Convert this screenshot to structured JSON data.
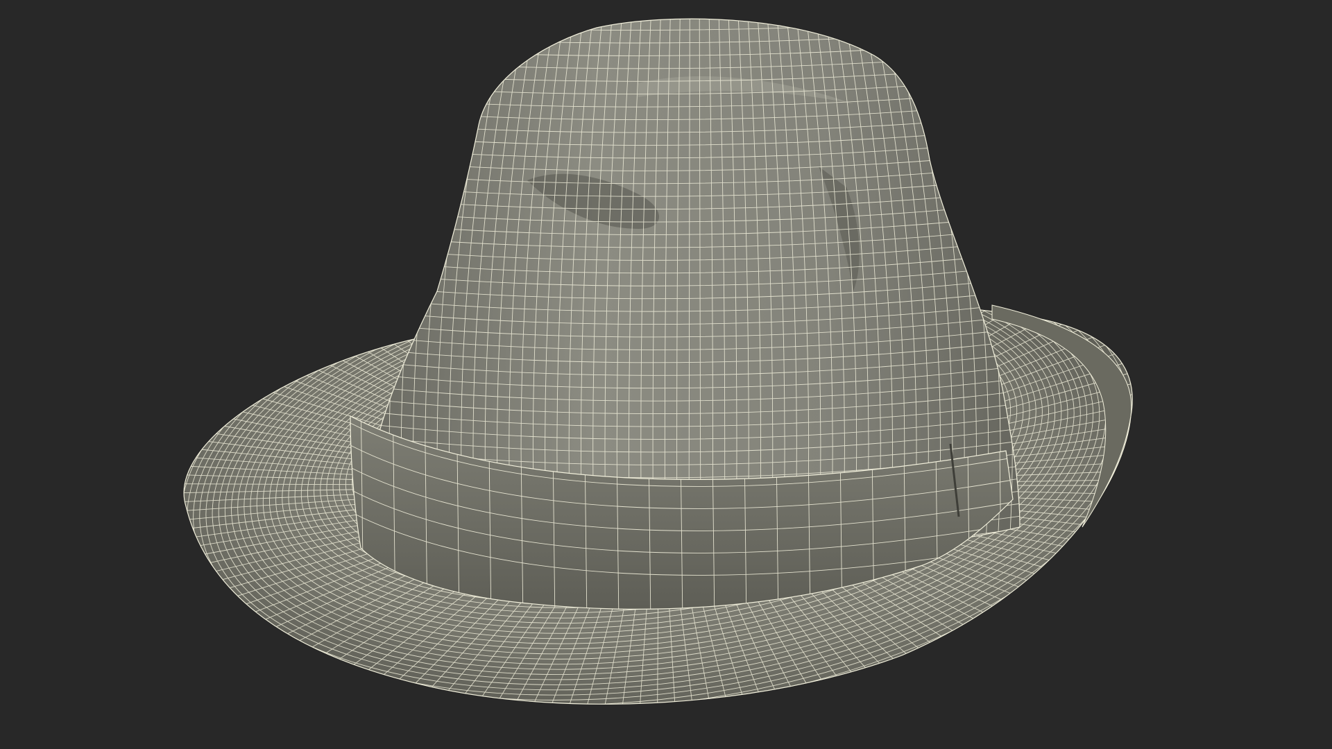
{
  "render": {
    "background_color": "#282828",
    "surface_color": "#7a7a70",
    "surface_highlight": "#9a9a8e",
    "surface_shadow": "#4e4e46",
    "wire_color": "#f2f0dc",
    "band_color": "#6e6e64"
  }
}
